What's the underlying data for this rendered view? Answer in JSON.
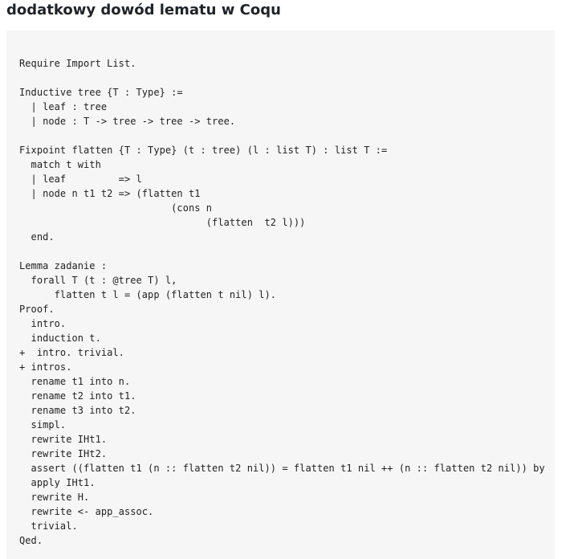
{
  "heading": "dodatkowy dowód lematu w Coqu",
  "code_lines": [
    "Require Import List.",
    "",
    "Inductive tree {T : Type} :=",
    "  | leaf : tree",
    "  | node : T -> tree -> tree -> tree.",
    "",
    "Fixpoint flatten {T : Type} (t : tree) (l : list T) : list T :=",
    "  match t with",
    "  | leaf         => l",
    "  | node n t1 t2 => (flatten t1",
    "                          (cons n",
    "                                (flatten  t2 l)))",
    "  end.",
    "",
    "Lemma zadanie :",
    "  forall T (t : @tree T) l,",
    "      flatten t l = (app (flatten t nil) l).",
    "Proof.",
    "  intro.",
    "  induction t.",
    "+  intro. trivial.",
    "+ intros.",
    "  rename t1 into n.",
    "  rename t2 into t1.",
    "  rename t3 into t2.",
    "  simpl.",
    "  rewrite IHt1.",
    "  rewrite IHt2.",
    "  assert ((flatten t1 (n :: flatten t2 nil)) = flatten t1 nil ++ (n :: flatten t2 nil)) by",
    "  apply IHt1.",
    "  rewrite H.",
    "  rewrite <- app_assoc.",
    "  trivial.",
    "Qed."
  ]
}
